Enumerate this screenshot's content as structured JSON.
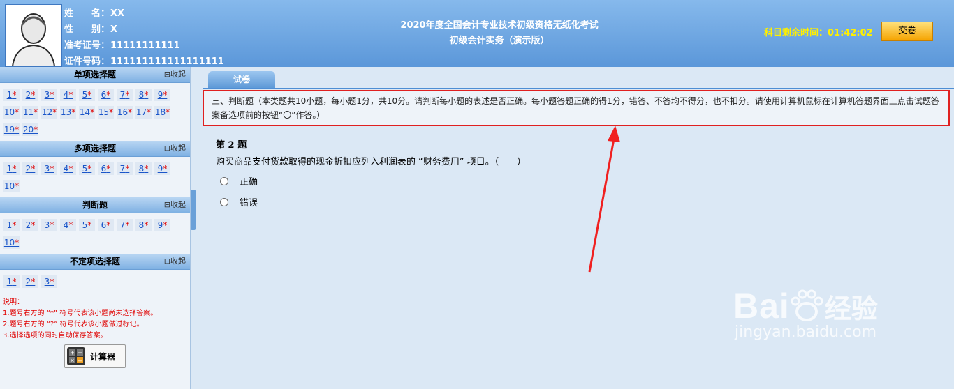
{
  "candidate": {
    "name_label": "姓　　名：",
    "name_value": "XX",
    "gender_label": "性　　别：",
    "gender_value": "X",
    "ticket_label": "准考证号：",
    "ticket_value": "11111111111",
    "id_label": "证件号码：",
    "id_value": "111111111111111111"
  },
  "header": {
    "title_line1": "2020年度全国会计专业技术初级资格无纸化考试",
    "title_line2": "初级会计实务（演示版）",
    "timer_label": "科目剩余时间：",
    "timer_value": "01:42:02",
    "submit_label": "交卷"
  },
  "sidebar": {
    "collapse_label": "收起",
    "sections": [
      {
        "title": "单项选择题",
        "items": [
          "1",
          "2",
          "3",
          "4",
          "5",
          "6",
          "7",
          "8",
          "9",
          "10",
          "11",
          "12",
          "13",
          "14",
          "15",
          "16",
          "17",
          "18",
          "19",
          "20"
        ]
      },
      {
        "title": "多项选择题",
        "items": [
          "1",
          "2",
          "3",
          "4",
          "5",
          "6",
          "7",
          "8",
          "9",
          "10"
        ]
      },
      {
        "title": "判断题",
        "items": [
          "1",
          "2",
          "3",
          "4",
          "5",
          "6",
          "7",
          "8",
          "9",
          "10"
        ]
      },
      {
        "title": "不定项选择题",
        "items": [
          "1",
          "2",
          "3"
        ]
      }
    ],
    "star": "*",
    "notes_title": "说明：",
    "notes": [
      "1.题号右方的 “*” 符号代表该小题尚未选择答案。",
      "2.题号右方的 “?” 符号代表该小题做过标记。",
      "3.选择选项的同时自动保存答案。"
    ],
    "calculator_label": "计算器"
  },
  "main": {
    "tab_label": "试卷",
    "instructions": "三、判断题（本类题共10小题，每小题1分，共10分。请判断每小题的表述是否正确。每小题答题正确的得1分，错答、不答均不得分，也不扣分。请使用计算机鼠标在计算机答题界面上点击试题答案备选项前的按钮“〇”作答。）",
    "question_title": "第 2 题",
    "question_text": "购买商品支付货款取得的现金折扣应列入利润表的 “财务费用” 项目。（　　）",
    "options": [
      "正确",
      "错误"
    ]
  },
  "watermark": {
    "brand": "Bai",
    "brand2": "经验",
    "url": "jingyan.baidu.com"
  },
  "colors": {
    "header_blue": "#5b97d9",
    "timer_yellow": "#fff000",
    "highlight_red": "#e02020",
    "link_blue": "#1a55c9"
  }
}
